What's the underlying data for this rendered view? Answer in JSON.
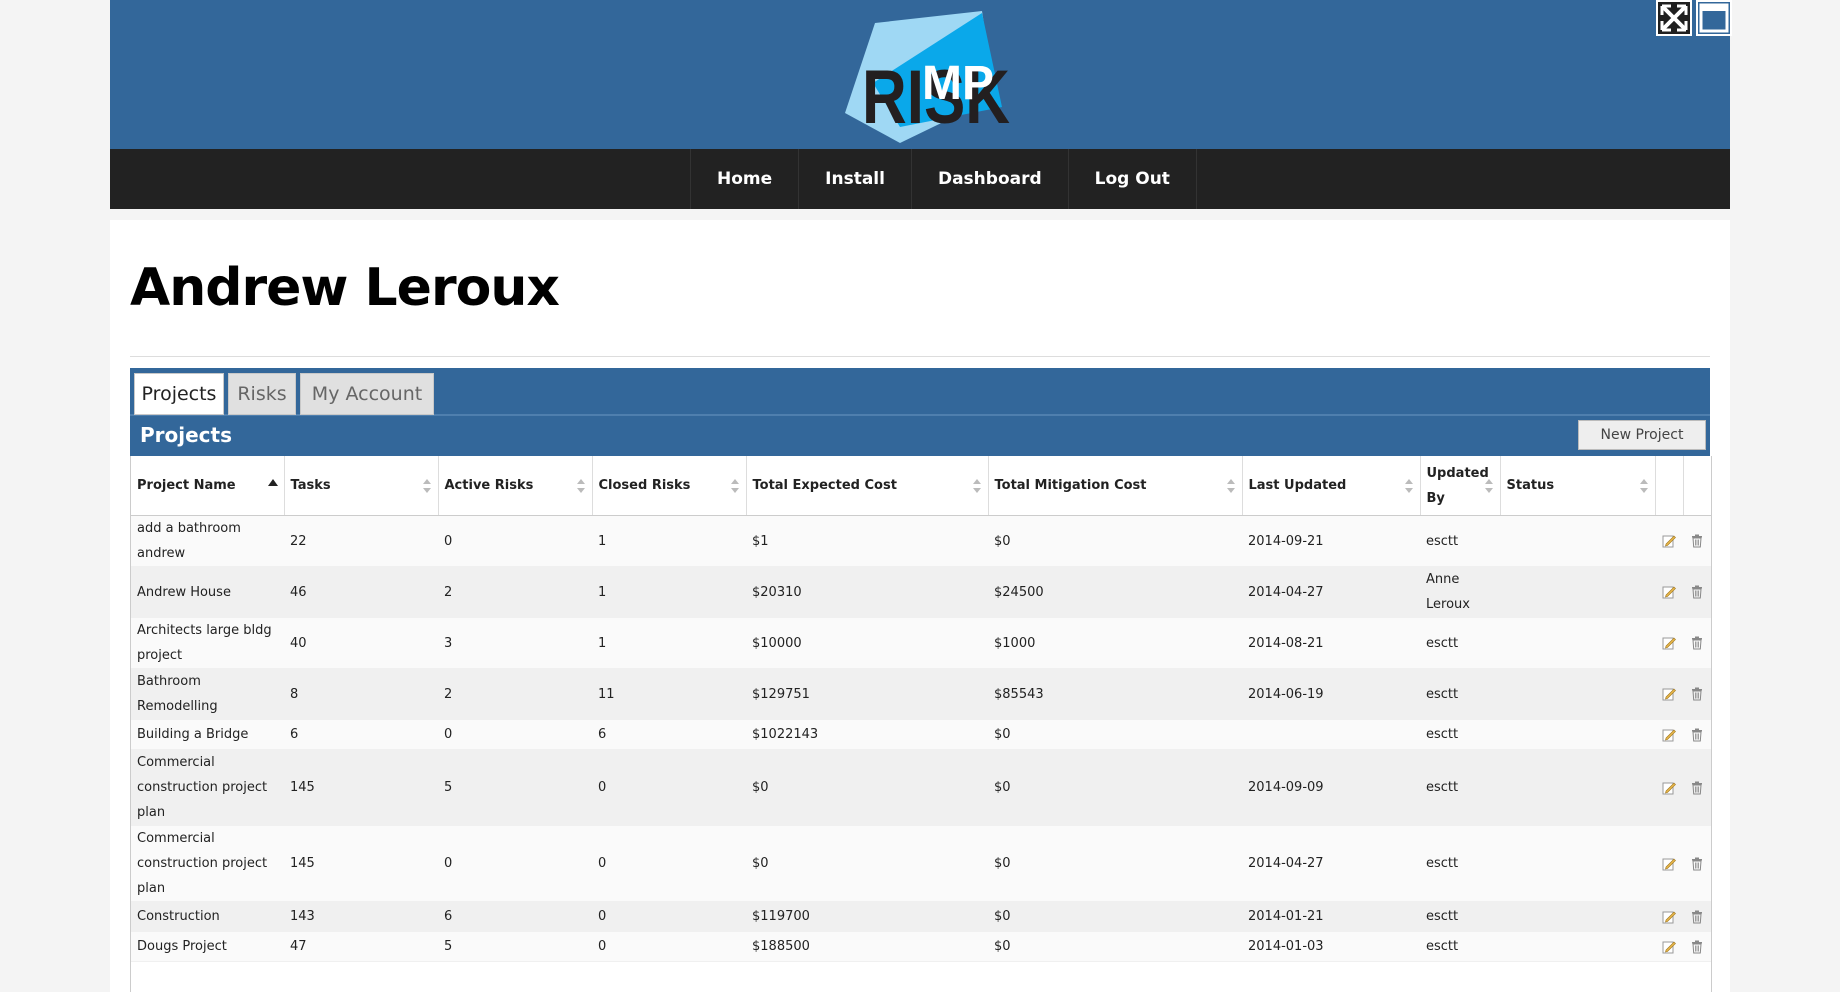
{
  "header": {
    "logo_text_dark": "RISK",
    "logo_text_light": "MP",
    "colors": {
      "header_bg": "#33679a",
      "nav_bg": "#222222",
      "logo_blue": "#0aa8ea"
    },
    "window_buttons": [
      "fullscreen-icon",
      "window-icon"
    ]
  },
  "nav": {
    "items": [
      "Home",
      "Install",
      "Dashboard",
      "Log Out"
    ]
  },
  "page": {
    "title": "Andrew Leroux"
  },
  "tabs": {
    "items": [
      "Projects",
      "Risks",
      "My Account"
    ],
    "active": "Projects"
  },
  "panel": {
    "title": "Projects",
    "new_button": "New Project"
  },
  "table": {
    "columns": [
      "Project Name",
      "Tasks",
      "Active Risks",
      "Closed Risks",
      "Total Expected Cost",
      "Total Mitigation Cost",
      "Last Updated",
      "Updated By",
      "Status"
    ],
    "sorted_column": "Project Name",
    "row_actions": [
      "edit-icon",
      "trash-icon"
    ],
    "rows": [
      {
        "name": "add a bathroom andrew",
        "tasks": "22",
        "active": "0",
        "closed": "1",
        "expected": "$1",
        "mitigation": "$0",
        "updated": "2014-09-21",
        "by": "esctt",
        "status": ""
      },
      {
        "name": "Andrew House",
        "tasks": "46",
        "active": "2",
        "closed": "1",
        "expected": "$20310",
        "mitigation": "$24500",
        "updated": "2014-04-27",
        "by": "Anne Leroux",
        "status": ""
      },
      {
        "name": "Architects large bldg project",
        "tasks": "40",
        "active": "3",
        "closed": "1",
        "expected": "$10000",
        "mitigation": "$1000",
        "updated": "2014-08-21",
        "by": "esctt",
        "status": ""
      },
      {
        "name": "Bathroom Remodelling",
        "tasks": "8",
        "active": "2",
        "closed": "11",
        "expected": "$129751",
        "mitigation": "$85543",
        "updated": "2014-06-19",
        "by": "esctt",
        "status": ""
      },
      {
        "name": "Building a Bridge",
        "tasks": "6",
        "active": "0",
        "closed": "6",
        "expected": "$1022143",
        "mitigation": "$0",
        "updated": "",
        "by": "esctt",
        "status": ""
      },
      {
        "name": "Commercial construction project plan",
        "tasks": "145",
        "active": "5",
        "closed": "0",
        "expected": "$0",
        "mitigation": "$0",
        "updated": "2014-09-09",
        "by": "esctt",
        "status": ""
      },
      {
        "name": "Commercial construction project plan",
        "tasks": "145",
        "active": "0",
        "closed": "0",
        "expected": "$0",
        "mitigation": "$0",
        "updated": "2014-04-27",
        "by": "esctt",
        "status": ""
      },
      {
        "name": "Construction",
        "tasks": "143",
        "active": "6",
        "closed": "0",
        "expected": "$119700",
        "mitigation": "$0",
        "updated": "2014-01-21",
        "by": "esctt",
        "status": ""
      },
      {
        "name": "Dougs Project",
        "tasks": "47",
        "active": "5",
        "closed": "0",
        "expected": "$188500",
        "mitigation": "$0",
        "updated": "2014-01-03",
        "by": "esctt",
        "status": ""
      }
    ]
  }
}
